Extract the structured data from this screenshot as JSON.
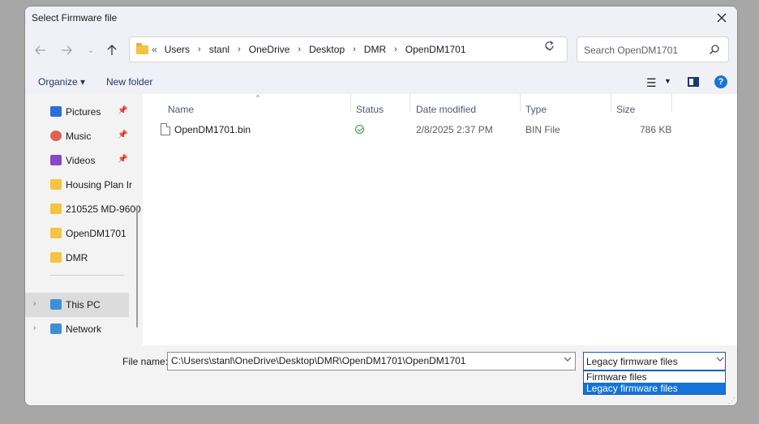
{
  "dialog": {
    "title": "Select Firmware file"
  },
  "address": {
    "overflow": "«",
    "crumbs": [
      "Users",
      "stanl",
      "OneDrive",
      "Desktop",
      "DMR",
      "OpenDM1701"
    ],
    "separator": "›"
  },
  "search": {
    "placeholder": "Search OpenDM1701"
  },
  "toolbar": {
    "organize": "Organize ▾",
    "new_folder": "New folder"
  },
  "sidebar": {
    "items": [
      {
        "label": "Pictures",
        "icon": "pictures-icon",
        "pinned": true,
        "color": "#2b6fd6"
      },
      {
        "label": "Music",
        "icon": "music-icon",
        "pinned": true,
        "color": "#e0614f"
      },
      {
        "label": "Videos",
        "icon": "videos-icon",
        "pinned": true,
        "color": "#8a46c9"
      },
      {
        "label": "Housing Plan Ir",
        "icon": "folder-icon",
        "pinned": false,
        "color": "#f5c342"
      },
      {
        "label": "210525 MD-9600",
        "icon": "folder-icon",
        "pinned": false,
        "color": "#f5c342"
      },
      {
        "label": "OpenDM1701",
        "icon": "folder-icon",
        "pinned": false,
        "color": "#f5c342"
      },
      {
        "label": "DMR",
        "icon": "folder-icon",
        "pinned": false,
        "color": "#f5c342"
      },
      {
        "label": "This PC",
        "icon": "this-pc-icon",
        "expandable": true,
        "selected": true,
        "color": "#3f8fd8"
      },
      {
        "label": "Network",
        "icon": "network-icon",
        "expandable": true,
        "color": "#3f8fd8"
      }
    ]
  },
  "files": {
    "columns": [
      "Name",
      "Status",
      "Date modified",
      "Type",
      "Size"
    ],
    "rows": [
      {
        "name": "OpenDM1701.bin",
        "status": "available",
        "date": "2/8/2025 2:37 PM",
        "type": "BIN File",
        "size": "786 KB"
      }
    ]
  },
  "footer": {
    "file_name_label": "File name:",
    "file_name_value": "C:\\Users\\stanl\\OneDrive\\Desktop\\DMR\\OpenDM1701\\OpenDM1701",
    "file_type_selected": "Legacy firmware files",
    "file_type_options": [
      "Firmware files",
      "Legacy firmware files"
    ]
  }
}
